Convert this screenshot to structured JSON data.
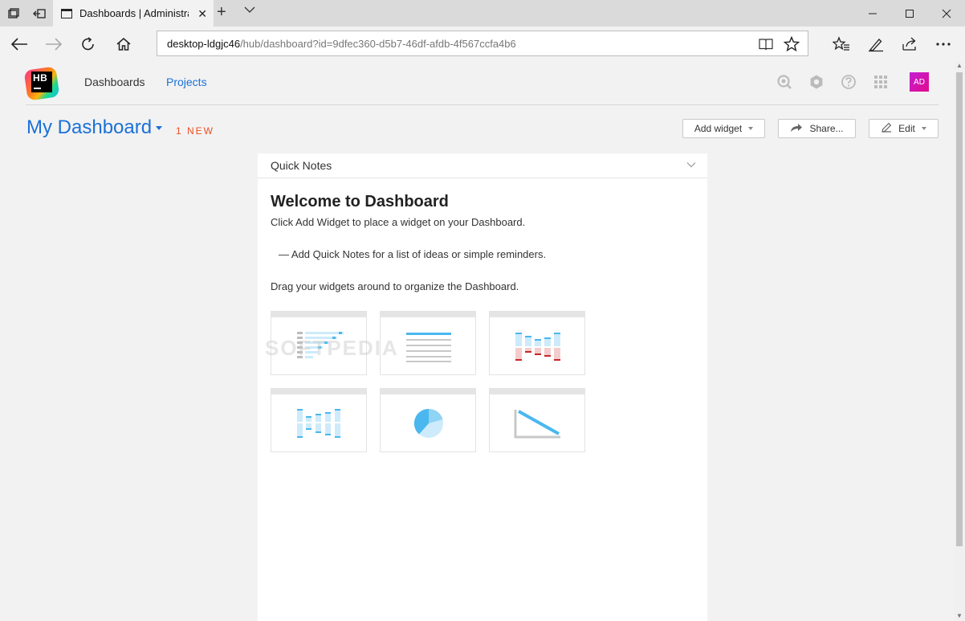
{
  "browser": {
    "tab_title": "Dashboards | Administra",
    "url_host": "desktop-ldgjc46",
    "url_path": "/hub/dashboard?id=9dfec360-d5b7-46df-afdb-4f567ccfa4b6"
  },
  "hub": {
    "logo_text": "HB",
    "nav": {
      "dashboards": "Dashboards",
      "projects": "Projects"
    },
    "avatar": "AD"
  },
  "dashboard": {
    "title": "My Dashboard",
    "new_badge": "1 NEW",
    "add_widget": "Add widget",
    "share": "Share...",
    "edit": "Edit"
  },
  "widget": {
    "title": "Quick Notes",
    "heading": "Welcome to Dashboard",
    "line1": "Click Add Widget to place a widget on your Dashboard.",
    "line2": "— Add Quick Notes for a list of ideas or simple reminders.",
    "line3": "Drag your widgets around to organize the Dashboard."
  },
  "watermark": "SOFTPEDIA",
  "colors": {
    "accent": "#1b71d8",
    "badge": "#f04e23",
    "avatar": "#d31bb0",
    "illustration_blue": "#4ab8ef",
    "illustration_light": "#cdebfa",
    "illustration_red": "#c62828"
  }
}
